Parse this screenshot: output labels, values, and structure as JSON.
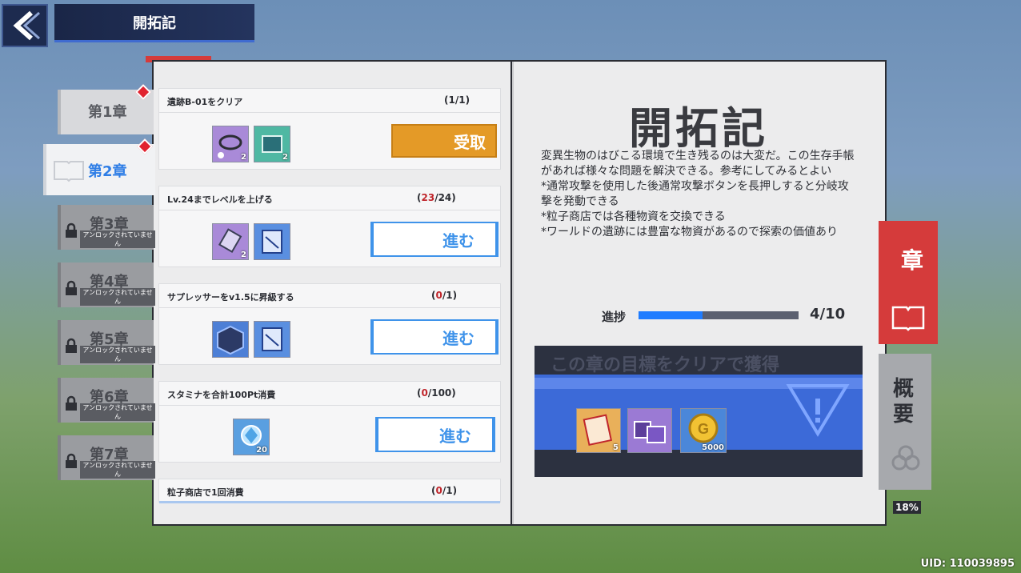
{
  "header": {
    "title": "開拓記"
  },
  "chapters": [
    {
      "label": "第1章",
      "state": "normal",
      "badge": true
    },
    {
      "label": "第2章",
      "state": "active",
      "badge": true
    },
    {
      "label": "第3章",
      "state": "locked",
      "sub": "アンロックされていません"
    },
    {
      "label": "第4章",
      "state": "locked",
      "sub": "アンロックされていません"
    },
    {
      "label": "第5章",
      "state": "locked",
      "sub": "アンロックされていません"
    },
    {
      "label": "第6章",
      "state": "locked",
      "sub": "アンロックされていません"
    },
    {
      "label": "第7章",
      "state": "locked",
      "sub": "アンロックされていません"
    }
  ],
  "quests": [
    {
      "title": "遺跡B-01をクリア",
      "current": "1",
      "total": "1",
      "button": "受取",
      "button_type": "claim",
      "rewards": [
        {
          "icon": "purple-bracelet-icon",
          "count": "2"
        },
        {
          "icon": "teal-box-icon",
          "count": "2"
        }
      ]
    },
    {
      "title": "Lv.24までレベルを上げる",
      "current": "23",
      "total": "24",
      "button": "進む",
      "button_type": "go",
      "rewards": [
        {
          "icon": "purple-device-icon",
          "count": "2"
        },
        {
          "icon": "blue-card-icon",
          "count": ""
        }
      ]
    },
    {
      "title": "サプレッサーをv1.5に昇級する",
      "current": "0",
      "total": "1",
      "button": "進む",
      "button_type": "go",
      "rewards": [
        {
          "icon": "blue-cube-icon",
          "count": ""
        },
        {
          "icon": "blue-card-icon",
          "count": ""
        }
      ]
    },
    {
      "title": "スタミナを合計100Pt消費",
      "current": "0",
      "total": "100",
      "button": "進む",
      "button_type": "go",
      "rewards": [
        {
          "icon": "crystal-orb-icon",
          "count": "20"
        }
      ]
    },
    {
      "title": "粒子商店で1回消費",
      "current": "0",
      "total": "1",
      "button": "",
      "button_type": "none",
      "rewards": []
    }
  ],
  "detail": {
    "title": "開拓記",
    "description": [
      "変異生物のはびこる環境で生き残るのは大変だ。この生存手帳があれば様々な問題を解決できる。参考にしてみるとよい",
      "*通常攻撃を使用した後通常攻撃ボタンを長押しすると分岐攻撃を発動できる",
      "*粒子商店では各種物資を交換できる",
      "*ワールドの遺跡には豊富な物資があるので探索の価値あり"
    ],
    "progress_label": "進捗",
    "progress_value": 4,
    "progress_max": 10,
    "progress_text": "4/10",
    "goal_title": "この章の目標をクリアで獲得",
    "goal_rewards": [
      {
        "icon": "orange-pack-icon",
        "count": "5"
      },
      {
        "icon": "purple-boxes-icon",
        "count": ""
      },
      {
        "icon": "gold-coin-icon",
        "count": "5000"
      }
    ]
  },
  "side_tabs": {
    "chapter": "章",
    "summary": "概要"
  },
  "percent": "18%",
  "uid": "UID: 110039895",
  "colors": {
    "accent_blue": "#3f93ea",
    "claim_orange": "#e49a27",
    "chapter_red": "#d53b3b"
  }
}
